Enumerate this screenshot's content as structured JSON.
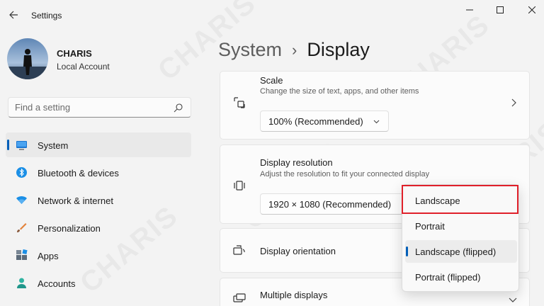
{
  "window": {
    "app_title": "Settings",
    "icons": {
      "back": "arrow-left-icon",
      "minimize": "minimize-icon",
      "maximize": "maximize-icon",
      "close": "close-icon"
    }
  },
  "user": {
    "name": "CHARIS",
    "account_type": "Local Account"
  },
  "search": {
    "placeholder": "Find a setting",
    "icon": "search-icon"
  },
  "sidebar": {
    "items": [
      {
        "label": "System",
        "icon": "monitor-icon",
        "active": true
      },
      {
        "label": "Bluetooth & devices",
        "icon": "bluetooth-icon"
      },
      {
        "label": "Network & internet",
        "icon": "wifi-icon"
      },
      {
        "label": "Personalization",
        "icon": "brush-icon"
      },
      {
        "label": "Apps",
        "icon": "apps-icon"
      },
      {
        "label": "Accounts",
        "icon": "person-icon"
      }
    ]
  },
  "breadcrumb": {
    "parent": "System",
    "separator": "›",
    "current": "Display"
  },
  "settings": {
    "scale": {
      "title": "Scale",
      "subtitle": "Change the size of text, apps, and other items",
      "value": "100% (Recommended)",
      "icon": "scale-icon"
    },
    "resolution": {
      "title": "Display resolution",
      "subtitle": "Adjust the resolution to fit your connected display",
      "value": "1920 × 1080 (Recommended)",
      "icon": "resolution-icon"
    },
    "orientation": {
      "title": "Display orientation",
      "icon": "orientation-icon"
    },
    "multiple": {
      "title": "Multiple displays",
      "icon": "multiple-displays-icon"
    }
  },
  "orientation_menu": {
    "options": [
      "Landscape",
      "Portrait",
      "Landscape (flipped)",
      "Portrait (flipped)"
    ],
    "selected": "Landscape (flipped)",
    "highlighted": "Landscape"
  },
  "watermark": "CHARIS",
  "colors": {
    "accent": "#005fb8",
    "highlight_border": "#e0202a",
    "background": "#f3f3f3"
  }
}
